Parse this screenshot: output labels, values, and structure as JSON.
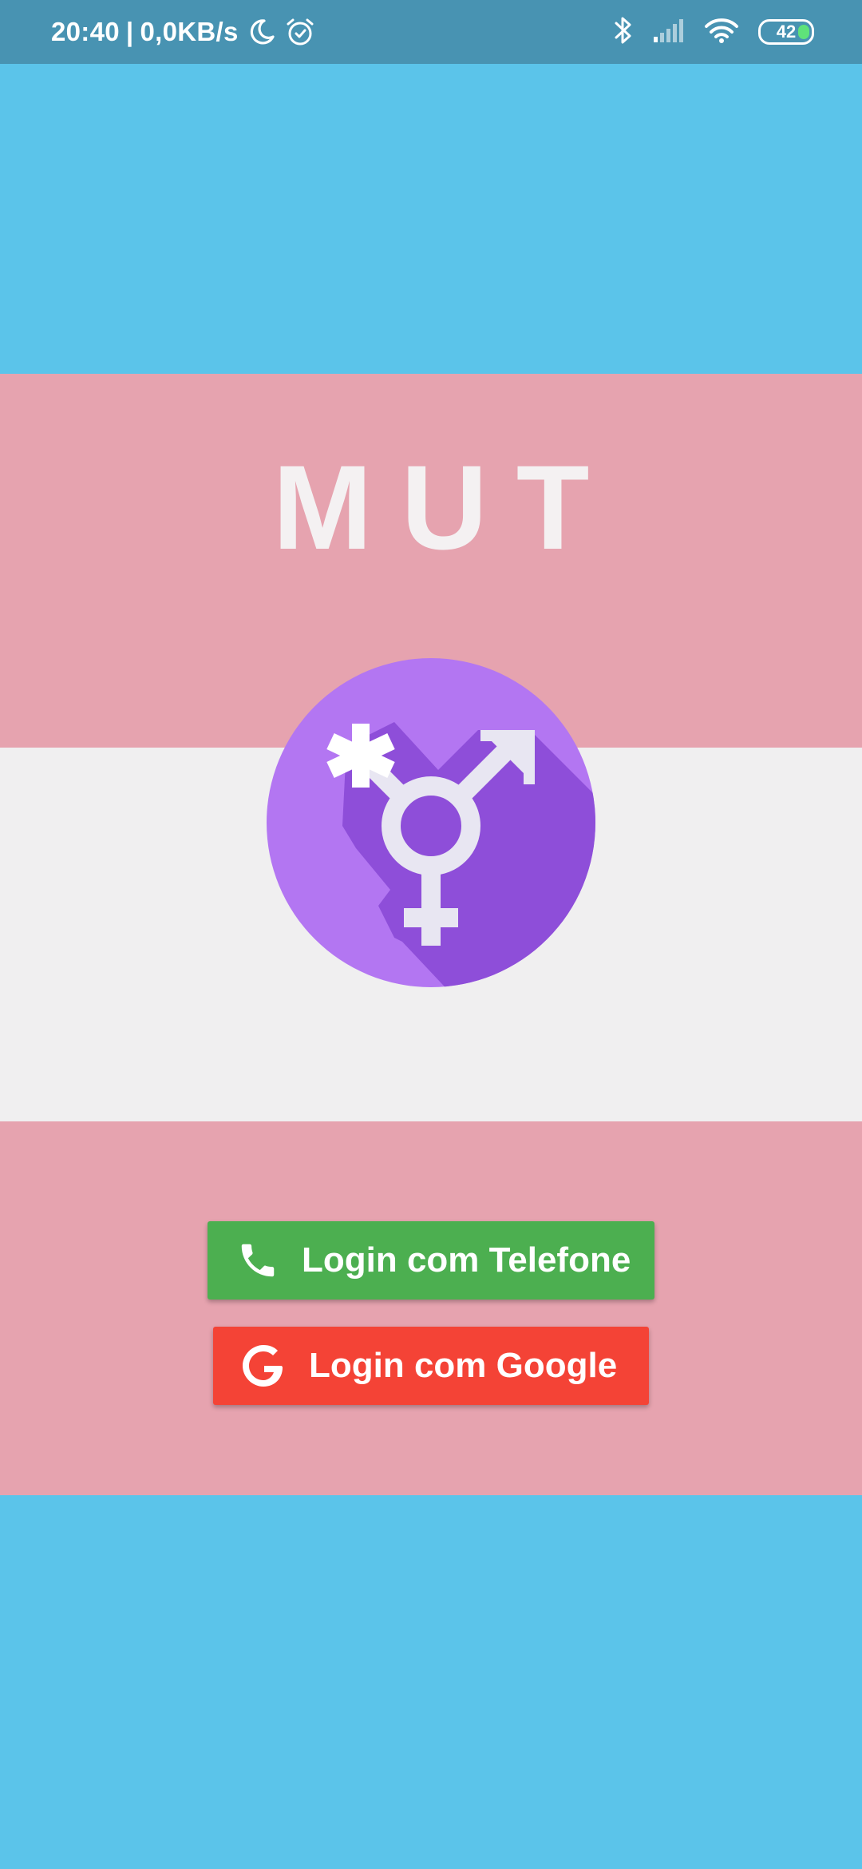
{
  "status_bar": {
    "time": "20:40",
    "separator": "|",
    "network_speed": "0,0KB/s",
    "icons_left": [
      "moon-icon",
      "alarm-icon"
    ],
    "icons_right": [
      "bluetooth-icon",
      "signal-icon",
      "wifi-icon",
      "battery-icon"
    ],
    "battery_level": "42"
  },
  "app": {
    "title": "MUT",
    "logo_icon": "transgender-symbol-icon"
  },
  "buttons": {
    "phone_label": "Login com Telefone",
    "phone_icon": "phone-icon",
    "google_label": "Login com Google",
    "google_icon": "google-g-icon"
  },
  "colors": {
    "flag_blue": "#5BC4EA",
    "flag_pink": "#E6A3AF",
    "flag_white": "#F0EFF0",
    "status_bar": "#4893B2",
    "phone_button": "#4CAF50",
    "google_button": "#F44336",
    "logo_purple_light": "#B376F2",
    "logo_purple_dark": "#8E4ED9"
  }
}
